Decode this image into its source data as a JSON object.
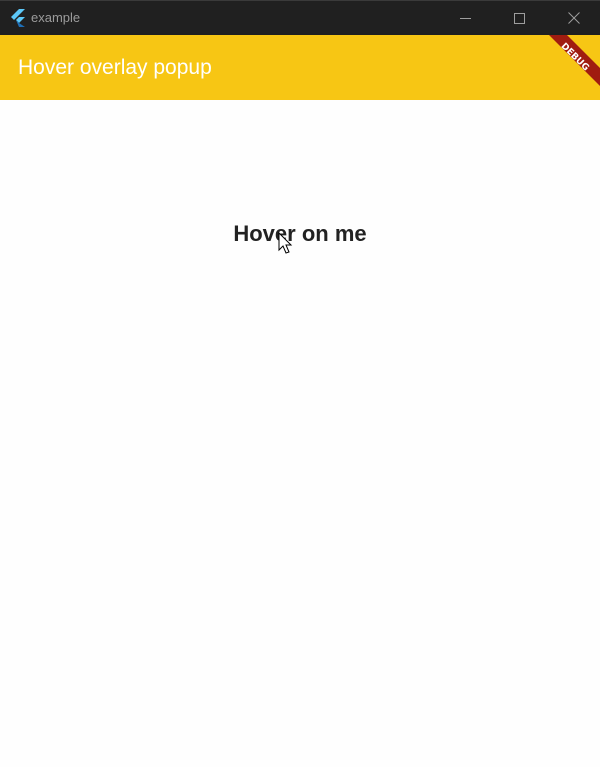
{
  "window": {
    "title": "example",
    "app_icon": "flutter-logo-icon",
    "controls": {
      "minimize_icon": "minimize-icon",
      "maximize_icon": "maximize-icon",
      "close_icon": "close-icon"
    }
  },
  "appbar": {
    "title": "Hover overlay popup",
    "color": "#f7c614",
    "debug_banner": "DEBUG",
    "debug_banner_color": "#a01c10"
  },
  "main": {
    "hover_text": "Hover on me",
    "cursor_icon": "mouse-pointer-icon"
  }
}
